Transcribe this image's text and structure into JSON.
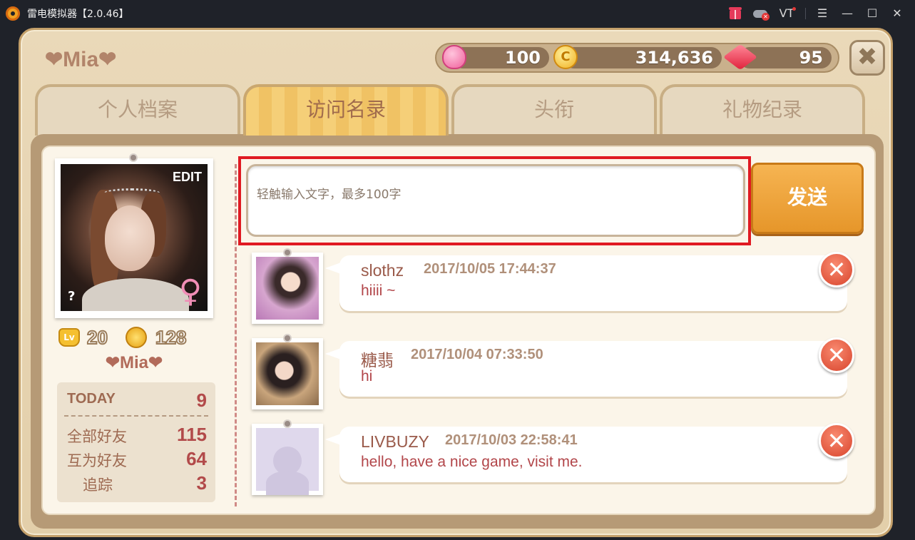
{
  "titlebar": {
    "app_title": "雷电模拟器【2.0.46】",
    "vt_label": "VT",
    "menu_icon": "☰",
    "minimize_icon": "—",
    "maximize_icon": "☐",
    "close_icon": "✕"
  },
  "game": {
    "player_name": "❤Mia❤",
    "currency": {
      "hearts": "100",
      "coins": "314,636",
      "rubies": "95"
    },
    "close_label": "✖",
    "tabs": [
      {
        "label": "个人档案"
      },
      {
        "label": "访问名录"
      },
      {
        "label": "头衔"
      },
      {
        "label": "礼物纪录"
      }
    ],
    "profile": {
      "edit_label": "EDIT",
      "unknown_mark": "?",
      "gender_symbol": "♀",
      "level": "20",
      "medals": "128",
      "name": "❤Mia❤",
      "today_label": "TODAY",
      "today_value": "9",
      "stats": [
        {
          "label": "全部好友",
          "value": "115"
        },
        {
          "label": "互为好友",
          "value": "64"
        },
        {
          "label": "追踪",
          "value": "3"
        }
      ]
    },
    "message_input": {
      "placeholder": "轻触输入文字，最多100字"
    },
    "send_label": "发送",
    "entries": [
      {
        "name": "slothz",
        "time": "2017/10/05  17:44:37",
        "message": "hiiii ~"
      },
      {
        "name": "糖翡",
        "time": "2017/10/04  07:33:50",
        "message": "hi"
      },
      {
        "name": "LIVBUZY",
        "time": "2017/10/03  22:58:41",
        "message": "hello, have a nice game, visit me."
      }
    ],
    "delete_label": "✕"
  },
  "colors": {
    "accent_red": "#e01a22",
    "tab_active": "#f5cf78",
    "send_button": "#e6962a",
    "delete_button": "#d8442c"
  },
  "icons": [
    "gift-icon",
    "gamepad-icon",
    "heart-icon",
    "coin-icon",
    "ruby-icon",
    "close-icon",
    "edit-icon",
    "female-icon",
    "level-icon",
    "medal-icon",
    "delete-icon"
  ]
}
